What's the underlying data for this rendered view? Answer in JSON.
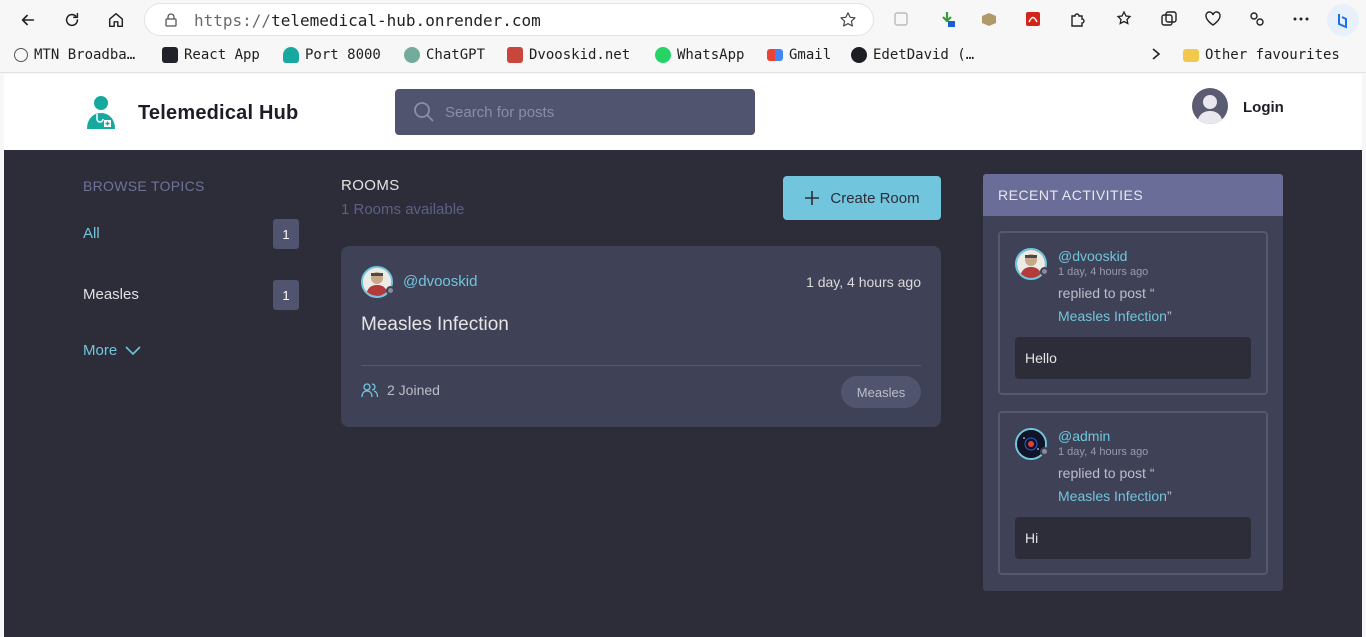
{
  "browser": {
    "url_scheme": "https://",
    "url_host": "telemedical-hub.onrender.com",
    "bookmarks": [
      {
        "label": "MTN Broadba…"
      },
      {
        "label": "React App"
      },
      {
        "label": "Port 8000"
      },
      {
        "label": "ChatGPT"
      },
      {
        "label": "Dvooskid.net"
      },
      {
        "label": "WhatsApp"
      },
      {
        "label": "Gmail"
      },
      {
        "label": "EdetDavid (…"
      }
    ],
    "other_favourites": "Other favourites"
  },
  "header": {
    "brand": "Telemedical Hub",
    "search_placeholder": "Search for posts",
    "login": "Login"
  },
  "sidebar": {
    "title": "BROWSE TOPICS",
    "topics": [
      {
        "label": "All",
        "count": "1"
      },
      {
        "label": "Measles",
        "count": "1"
      }
    ],
    "more": "More"
  },
  "rooms": {
    "title": "ROOMS",
    "subtitle": "1 Rooms available",
    "create_label": "Create Room",
    "items": [
      {
        "user": "@dvooskid",
        "time": "1 day, 4 hours ago",
        "title": "Measles Infection",
        "joined": "2 Joined",
        "topic": "Measles"
      }
    ]
  },
  "activities": {
    "title": "RECENT ACTIVITIES",
    "items": [
      {
        "user": "@dvooskid",
        "time": "1 day, 4 hours ago",
        "action": "replied to post “",
        "post": "Measles Infection",
        "close_quote": "”",
        "body": "Hello"
      },
      {
        "user": "@admin",
        "time": "1 day, 4 hours ago",
        "action": "replied to post “",
        "post": "Measles Infection",
        "close_quote": "”",
        "body": "Hi"
      }
    ]
  },
  "colors": {
    "accent": "#71c6dd",
    "page_bg": "#2d2d39",
    "card_bg": "#3f4156",
    "activity_header": "#696d97"
  }
}
